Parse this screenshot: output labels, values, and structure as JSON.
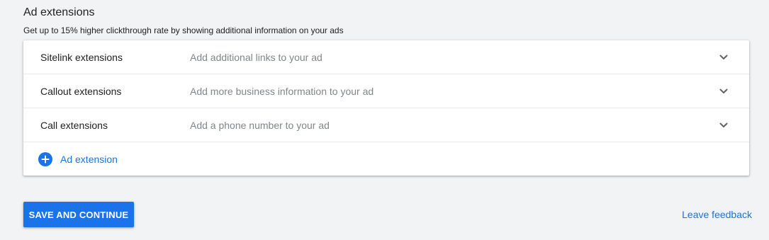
{
  "section": {
    "title": "Ad extensions",
    "subtitle": "Get up to 15% higher clickthrough rate by showing additional information on your ads"
  },
  "extensions": [
    {
      "name": "Sitelink extensions",
      "description": "Add additional links to your ad",
      "icon": "chevron-down-icon"
    },
    {
      "name": "Callout extensions",
      "description": "Add more business information to your ad",
      "icon": "chevron-down-icon"
    },
    {
      "name": "Call extensions",
      "description": "Add a phone number to your ad",
      "icon": "chevron-down-icon"
    }
  ],
  "add_extension": {
    "label": "Ad extension",
    "icon": "add-circle-icon"
  },
  "footer": {
    "save_label": "SAVE AND CONTINUE",
    "feedback_label": "Leave feedback"
  },
  "colors": {
    "accent": "#1a73e8",
    "background": "#f1f3f4",
    "secondary_text": "#80868b"
  }
}
